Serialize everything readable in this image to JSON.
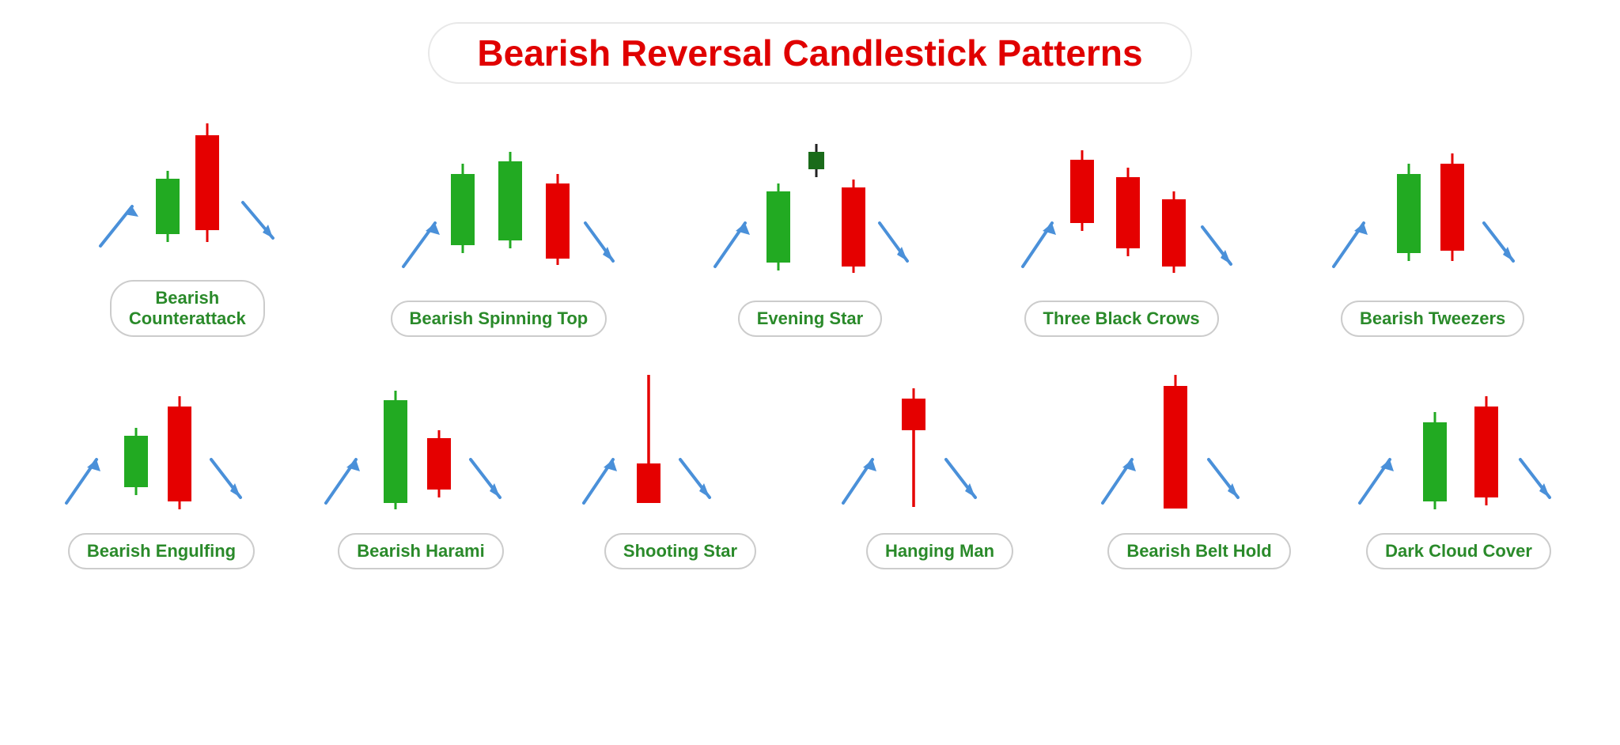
{
  "title": "Bearish Reversal Candlestick Patterns",
  "row1": [
    {
      "id": "bearish-counterattack",
      "label": "Bearish\nCounterattack"
    },
    {
      "id": "bearish-spinning-top",
      "label": "Bearish Spinning Top"
    },
    {
      "id": "evening-star",
      "label": "Evening Star"
    },
    {
      "id": "three-black-crows",
      "label": "Three Black Crows"
    },
    {
      "id": "bearish-tweezers",
      "label": "Bearish Tweezers"
    }
  ],
  "row2": [
    {
      "id": "bearish-engulfing",
      "label": "Bearish Engulfing"
    },
    {
      "id": "bearish-harami",
      "label": "Bearish Harami"
    },
    {
      "id": "shooting-star",
      "label": "Shooting Star"
    },
    {
      "id": "hanging-man",
      "label": "Hanging Man"
    },
    {
      "id": "bearish-belt-hold",
      "label": "Bearish Belt Hold"
    },
    {
      "id": "dark-cloud-cover",
      "label": "Dark Cloud Cover"
    }
  ],
  "colors": {
    "bull": "#22aa22",
    "bear": "#e50000",
    "arrow": "#4a90d9",
    "title": "#e00000"
  }
}
